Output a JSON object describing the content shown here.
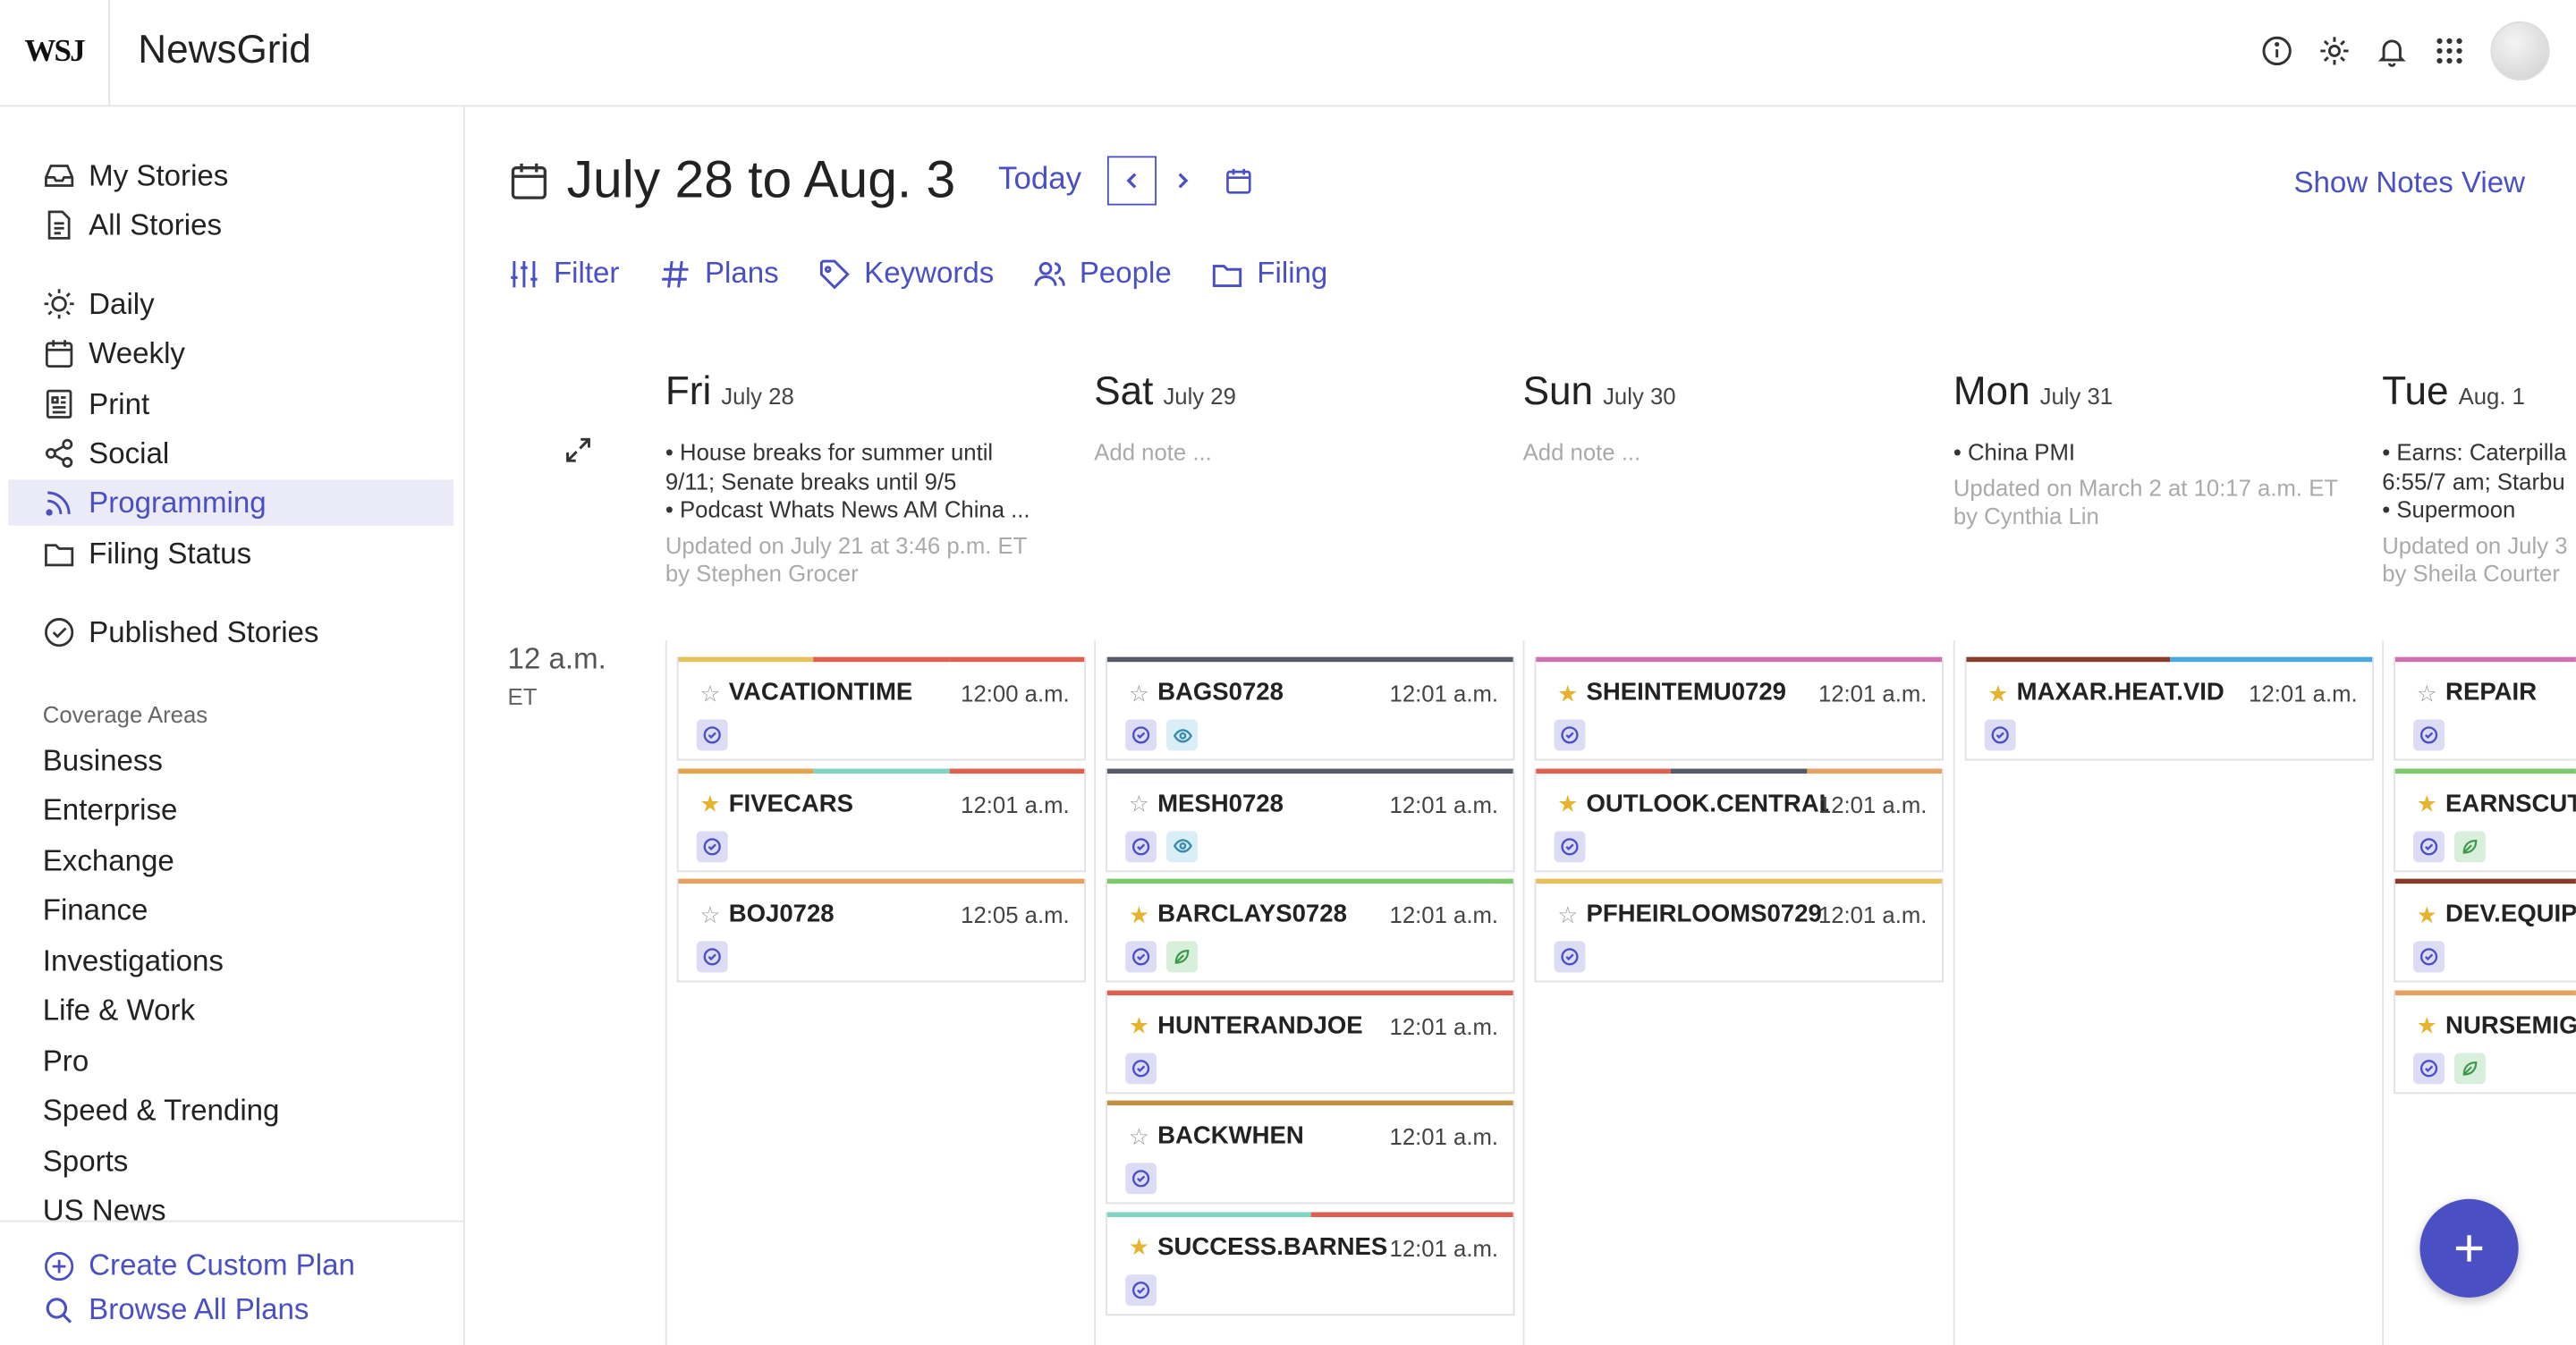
{
  "app": {
    "logo": "WSJ",
    "name": "NewsGrid"
  },
  "header_icons": [
    "info-icon",
    "gear-icon",
    "bell-icon",
    "apps-grid-icon",
    "avatar"
  ],
  "sidebar": {
    "items_top": [
      {
        "label": "My Stories",
        "icon": "inbox-icon"
      },
      {
        "label": "All Stories",
        "icon": "document-icon"
      }
    ],
    "items_views": [
      {
        "label": "Daily",
        "icon": "sun-icon"
      },
      {
        "label": "Weekly",
        "icon": "calendar-icon"
      },
      {
        "label": "Print",
        "icon": "newspaper-icon"
      },
      {
        "label": "Social",
        "icon": "share-icon"
      },
      {
        "label": "Programming",
        "icon": "rss-icon",
        "active": true
      },
      {
        "label": "Filing Status",
        "icon": "folder-icon"
      }
    ],
    "published": {
      "label": "Published Stories",
      "icon": "check-circle-icon"
    },
    "coverage_label": "Coverage Areas",
    "coverage": [
      "Business",
      "Enterprise",
      "Exchange",
      "Finance",
      "Investigations",
      "Life & Work",
      "Pro",
      "Speed & Trending",
      "Sports",
      "US News"
    ],
    "create_plan": "Create Custom Plan",
    "browse_plans": "Browse All Plans"
  },
  "main": {
    "date_range": "July 28 to Aug. 3",
    "today": "Today",
    "show_notes": "Show Notes View",
    "toolbar": {
      "filter": "Filter",
      "plans": "Plans",
      "keywords": "Keywords",
      "people": "People",
      "filing": "Filing"
    },
    "time_label": "12 a.m.",
    "timezone": "ET"
  },
  "days": [
    {
      "name": "Fri",
      "date": "July 28",
      "notes": [
        "• House breaks for summer until",
        "9/11; Senate breaks until 9/5",
        "• Podcast  Whats News AM China ..."
      ],
      "updated": "Updated on July 21 at 3:46 p.m. ET",
      "by": "by Stephen Grocer",
      "cards": [
        {
          "slug": "VACATIONTIME",
          "time": "12:00 a.m.",
          "star": false,
          "colors": [
            "#e6c15a",
            "#e06050",
            "#e06050"
          ],
          "badges": [
            "check"
          ]
        },
        {
          "slug": "FIVECARS",
          "time": "12:01 a.m.",
          "star": true,
          "colors": [
            "#e6a24a",
            "#7fd4c4",
            "#e06050"
          ],
          "badges": [
            "check"
          ]
        },
        {
          "slug": "BOJ0728",
          "time": "12:05 a.m.",
          "star": false,
          "colors": [
            "#e8a060"
          ],
          "badges": [
            "check"
          ]
        }
      ]
    },
    {
      "name": "Sat",
      "date": "July 29",
      "add_note": "Add note ...",
      "cards": [
        {
          "slug": "BAGS0728",
          "time": "12:01 a.m.",
          "star": false,
          "colors": [
            "#555a66"
          ],
          "badges": [
            "check",
            "eye"
          ]
        },
        {
          "slug": "MESH0728",
          "time": "12:01 a.m.",
          "star": false,
          "colors": [
            "#555a66"
          ],
          "badges": [
            "check",
            "eye"
          ]
        },
        {
          "slug": "BARCLAYS0728",
          "time": "12:01 a.m.",
          "star": true,
          "colors": [
            "#7bc96a"
          ],
          "badges": [
            "check",
            "leaf"
          ]
        },
        {
          "slug": "HUNTERANDJOE",
          "time": "12:01 a.m.",
          "star": true,
          "colors": [
            "#e06050"
          ],
          "badges": [
            "check"
          ]
        },
        {
          "slug": "BACKWHEN",
          "time": "12:01 a.m.",
          "star": false,
          "colors": [
            "#c09040"
          ],
          "badges": [
            "check"
          ]
        },
        {
          "slug": "SUCCESS.BARNES",
          "time": "12:01 a.m.",
          "star": true,
          "colors": [
            "#7fd4c4",
            "#e06050"
          ],
          "badges": [
            "check"
          ]
        }
      ]
    },
    {
      "name": "Sun",
      "date": "July 30",
      "add_note": "Add note ...",
      "cards": [
        {
          "slug": "SHEINTEMU0729",
          "time": "12:01 a.m.",
          "star": true,
          "colors": [
            "#d070b0"
          ],
          "badges": [
            "check"
          ]
        },
        {
          "slug": "OUTLOOK.CENTRAL...",
          "time": "12:01 a.m.",
          "star": true,
          "colors": [
            "#e06050",
            "#555a66",
            "#e8a060"
          ],
          "badges": [
            "check"
          ]
        },
        {
          "slug": "PFHEIRLOOMS0729",
          "time": "12:01 a.m.",
          "star": false,
          "colors": [
            "#e6c15a"
          ],
          "badges": [
            "check"
          ]
        }
      ]
    },
    {
      "name": "Mon",
      "date": "July 31",
      "notes": [
        "• China PMI"
      ],
      "updated": "Updated on March 2 at 10:17 a.m. ET",
      "by": "by Cynthia Lin",
      "cards": [
        {
          "slug": "MAXAR.HEAT.VID",
          "time": "12:01 a.m.",
          "star": true,
          "colors": [
            "#8a3a2a",
            "#4aa8e0"
          ],
          "badges": [
            "check"
          ]
        }
      ]
    },
    {
      "name": "Tue",
      "date": "Aug. 1",
      "notes": [
        "• Earns: Caterpilla",
        "6:55/7 am; Starbu",
        "• Supermoon"
      ],
      "updated": "Updated on July 3",
      "by": "by Sheila Courter",
      "cards": [
        {
          "slug": "REPAIR",
          "time": "",
          "star": false,
          "colors": [
            "#d070b0"
          ],
          "badges": [
            "check"
          ]
        },
        {
          "slug": "EARNSCUT",
          "time": "",
          "star": true,
          "colors": [
            "#7bc96a"
          ],
          "badges": [
            "check",
            "leaf"
          ]
        },
        {
          "slug": "DEV.EQUIPP",
          "time": "",
          "star": true,
          "colors": [
            "#8a3a2a",
            "#e8a060"
          ],
          "badges": [
            "check"
          ]
        },
        {
          "slug": "NURSEMIGR",
          "time": "",
          "star": true,
          "colors": [
            "#e8a060"
          ],
          "badges": [
            "check",
            "leaf"
          ]
        }
      ]
    }
  ]
}
